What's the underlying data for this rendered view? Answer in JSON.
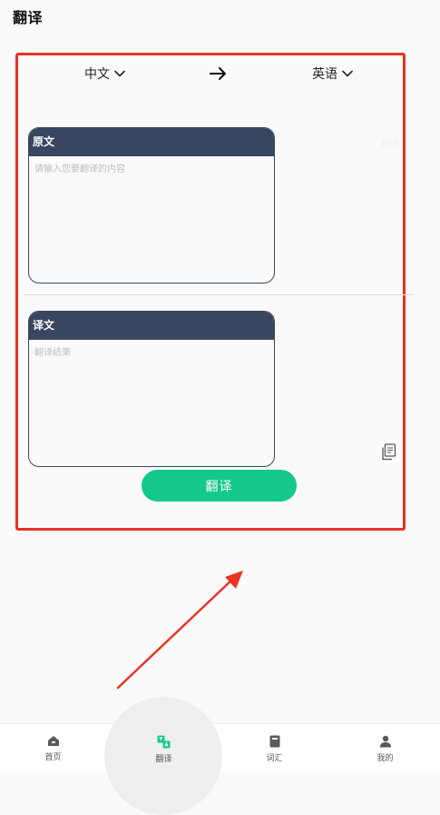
{
  "header": {
    "title": "翻译"
  },
  "language_bar": {
    "source_language": "中文",
    "target_language": "英语",
    "chevron_icon": "chevron-down-icon",
    "swap_icon": "arrow-right-icon"
  },
  "source_card": {
    "label": "原文",
    "placeholder": "请输入您要翻译的内容",
    "value": ""
  },
  "result_card": {
    "label": "译文",
    "placeholder": "翻译结果"
  },
  "ghost_label": "翻译",
  "actions": {
    "translate_label": "翻译",
    "copy_icon": "copy-icon"
  },
  "colors": {
    "accent": "#13c98a",
    "card_header": "#3a4660",
    "annotation": "#ea3323",
    "background": "#fafafa"
  },
  "tabbar": {
    "items": [
      {
        "label": "首页",
        "icon": "home-icon",
        "active": false
      },
      {
        "label": "翻译",
        "icon": "translate-icon",
        "active": true
      },
      {
        "label": "词汇",
        "icon": "book-icon",
        "active": false
      },
      {
        "label": "我的",
        "icon": "user-icon",
        "active": false
      }
    ]
  }
}
